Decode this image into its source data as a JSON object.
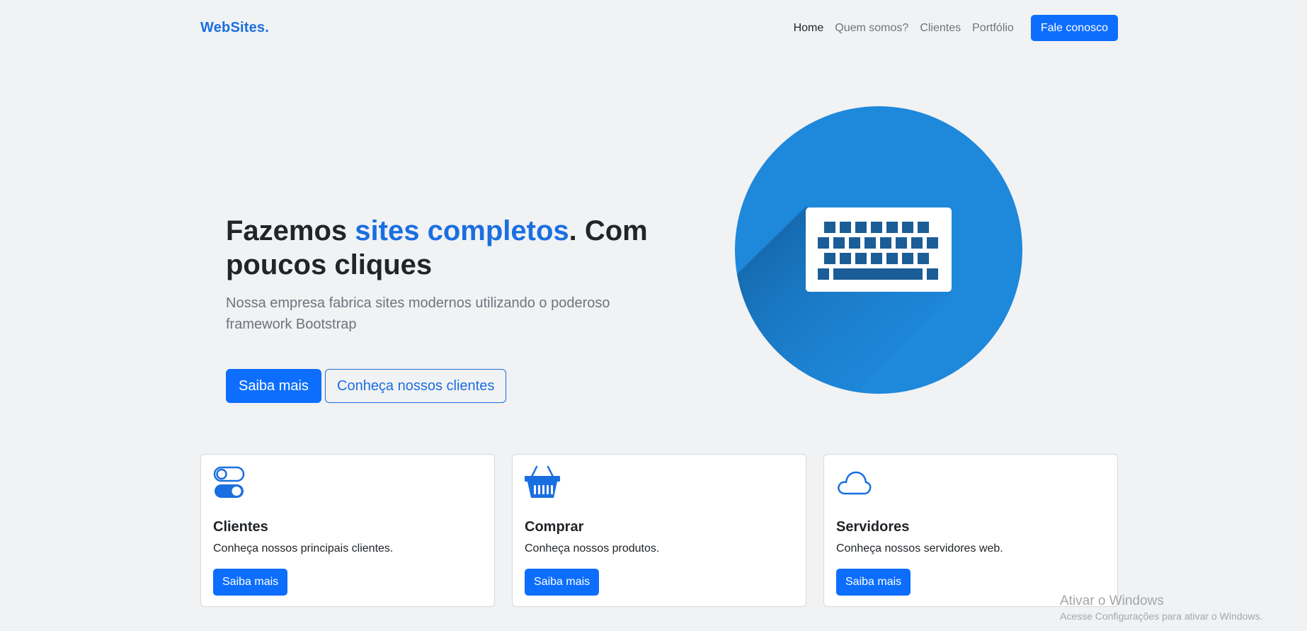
{
  "nav": {
    "brand": "WebSites.",
    "links": [
      "Home",
      "Quem somos?",
      "Clientes",
      "Portfólio"
    ],
    "cta": "Fale conosco"
  },
  "hero": {
    "title_pre": "Fazemos ",
    "title_accent": "sites completos",
    "title_post": ". Com poucos cliques",
    "lead": "Nossa empresa fabrica sites modernos utilizando o poderoso framework Bootstrap",
    "btn_primary": "Saiba mais",
    "btn_secondary": "Conheça nossos clientes",
    "image_icon": "keyboard-icon"
  },
  "cards": [
    {
      "icon": "toggles-icon",
      "title": "Clientes",
      "text": "Conheça nossos principais clientes.",
      "button": "Saiba mais"
    },
    {
      "icon": "basket-icon",
      "title": "Comprar",
      "text": "Conheça nossos produtos.",
      "button": "Saiba mais"
    },
    {
      "icon": "cloud-icon",
      "title": "Servidores",
      "text": "Conheça nossos servidores web.",
      "button": "Saiba mais"
    }
  ],
  "watermark": {
    "title": "Ativar o Windows",
    "subtitle": "Acesse Configurações para ativar o Windows."
  },
  "colors": {
    "primary": "#0d6efd",
    "accent": "#1a6fe0",
    "background": "#f1f2f4",
    "hero_circle": "#1e88db"
  }
}
